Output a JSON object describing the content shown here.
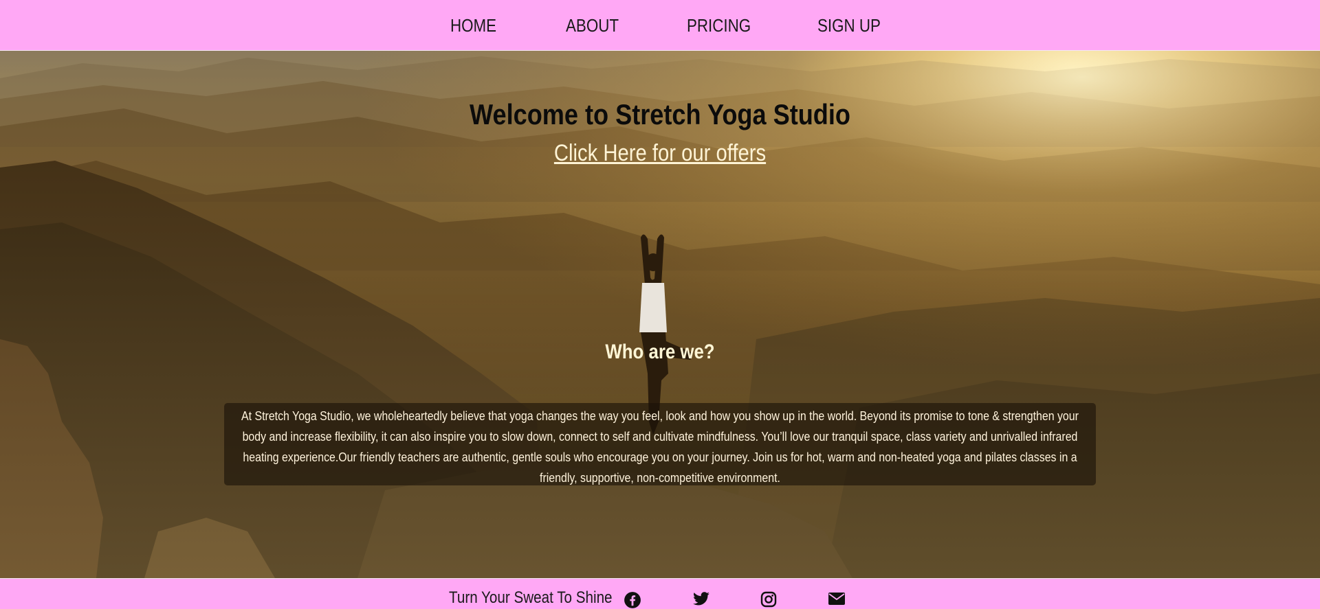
{
  "nav": {
    "items": [
      {
        "label": "HOME"
      },
      {
        "label": "ABOUT"
      },
      {
        "label": "PRICING"
      },
      {
        "label": "SIGN UP"
      }
    ]
  },
  "hero": {
    "title": "Welcome to Stretch Yoga Studio",
    "offers_link": "Click Here for our offers",
    "background_image": "silhouette of woman in tree pose on mountain at sunset"
  },
  "about": {
    "heading": "Who are we?",
    "text": "At Stretch Yoga Studio, we wholeheartedly believe that yoga changes the way you feel, look and how you show up in the world. Beyond its promise to tone & strengthen your body and increase flexibility, it can also inspire you to slow down, connect to self and cultivate mindfulness. You’ll love our tranquil space, class variety and unrivalled infrared heating experience.Our friendly teachers are authentic, gentle souls who encourage you on your journey. Join us for hot, warm and non-heated yoga and pilates classes in a friendly, supportive, non-competitive environment."
  },
  "footer": {
    "tagline": "Turn Your Sweat To Shine",
    "social": [
      {
        "icon": "facebook-icon"
      },
      {
        "icon": "twitter-icon"
      },
      {
        "icon": "instagram-icon"
      },
      {
        "icon": "email-icon"
      }
    ]
  },
  "colors": {
    "nav_background": "#ffa8f5",
    "footer_background": "#ffa8f5",
    "title_text": "#0b0b0b",
    "light_text": "#fff3dc"
  }
}
